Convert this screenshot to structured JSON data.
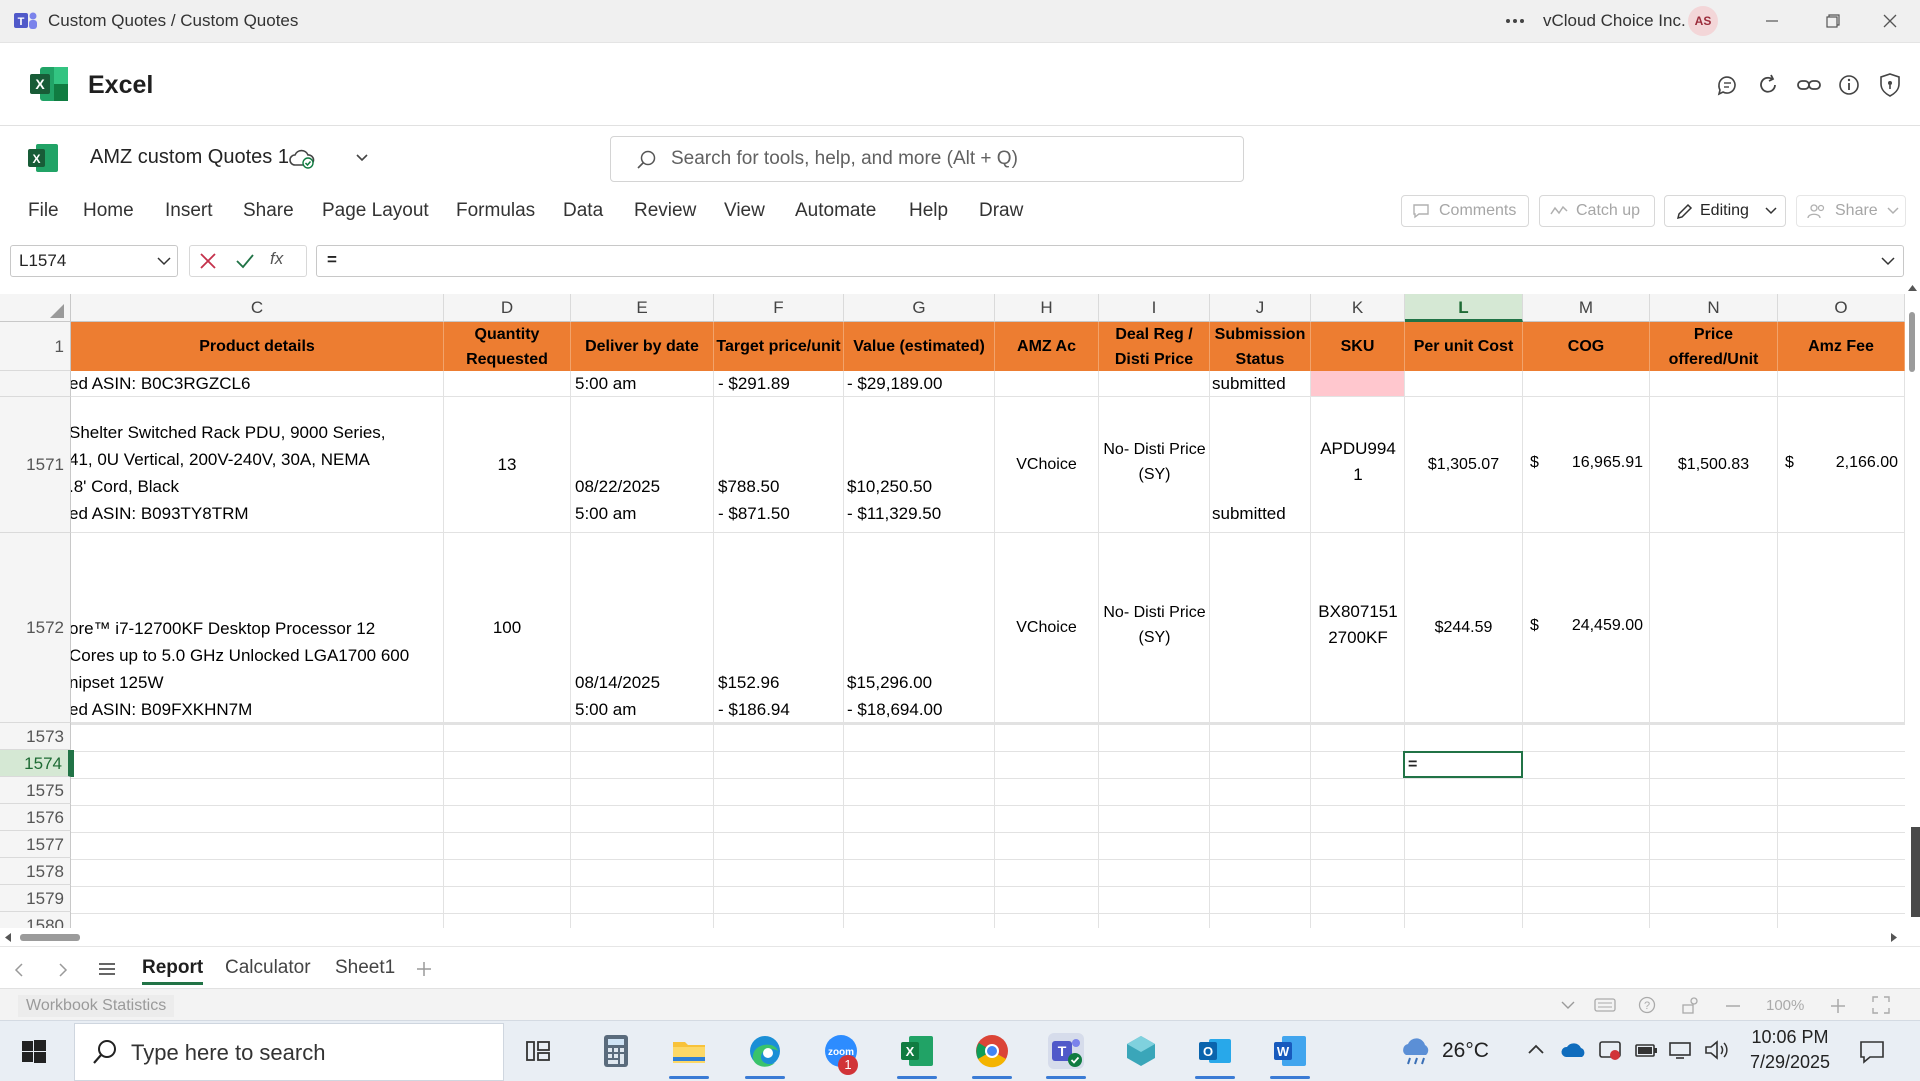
{
  "window": {
    "title": "Custom Quotes / Custom Quotes",
    "org": "vCloud Choice Inc.",
    "avatar": "AS"
  },
  "app": {
    "name": "Excel"
  },
  "file": {
    "name": "AMZ custom Quotes 1"
  },
  "search": {
    "placeholder": "Search for tools, help, and more (Alt + Q)"
  },
  "menu": {
    "items": [
      "File",
      "Home",
      "Insert",
      "Share",
      "Page Layout",
      "Formulas",
      "Data",
      "Review",
      "View",
      "Automate",
      "Help",
      "Draw"
    ],
    "comments": "Comments",
    "catch_up": "Catch up",
    "editing": "Editing",
    "share": "Share"
  },
  "formula_bar": {
    "name_box": "L1574",
    "fx": "fx",
    "formula": "="
  },
  "grid": {
    "columns": [
      "C",
      "D",
      "E",
      "F",
      "G",
      "H",
      "I",
      "J",
      "K",
      "L",
      "M",
      "N",
      "O"
    ],
    "selected_column": "L",
    "header_row_number": "1",
    "headers": {
      "C": "Product details",
      "D1": "Quantity",
      "D2": "Requested",
      "E": "Deliver by date",
      "F": "Target price/unit",
      "G": "Value (estimated)",
      "H": "AMZ Ac",
      "I1": "Deal Reg /",
      "I2": "Disti Price",
      "J1": "Submission",
      "J2": "Status",
      "K": "SKU",
      "L": "Per unit Cost",
      "M": "COG",
      "N1": "Price",
      "N2": "offered/Unit",
      "O": "Amz Fee"
    },
    "row_partial": {
      "c": "ed ASIN: B0C3RGZCL6",
      "e": "5:00 am",
      "f": "- $291.89",
      "g": "- $29,189.00",
      "j": "submitted"
    },
    "row_1571": {
      "num": "1571",
      "c1": "Shelter Switched Rack PDU, 9000 Series,",
      "c2": "41, 0U Vertical, 200V-240V, 30A, NEMA",
      "c3": ".8' Cord, Black",
      "c4": "ed ASIN: B093TY8TRM",
      "d": "13",
      "e1": "08/22/2025",
      "e2": "5:00 am",
      "f1": "$788.50",
      "f2": "- $871.50",
      "g1": "$10,250.50",
      "g2": "- $11,329.50",
      "h": "VChoice",
      "i1": "No- Disti Price",
      "i2": "(SY)",
      "j": "submitted",
      "k1": "APDU994",
      "k2": "1",
      "l": "$1,305.07",
      "m_sym": "$",
      "m": "16,965.91",
      "n": "$1,500.83",
      "o_sym": "$",
      "o": "2,166.00"
    },
    "row_1572": {
      "num": "1572",
      "c1": "ore™ i7-12700KF Desktop Processor 12",
      "c2": "Cores up to 5.0 GHz Unlocked LGA1700 600",
      "c3": "nipset 125W",
      "c4": "ed ASIN: B09FXKHN7M",
      "d": "100",
      "e1": "08/14/2025",
      "e2": "5:00 am",
      "f1": "$152.96",
      "f2": "- $186.94",
      "g1": "$15,296.00",
      "g2": "- $18,694.00",
      "h": "VChoice",
      "i1": "No- Disti Price",
      "i2": "(SY)",
      "k1": "BX807151",
      "k2": "2700KF",
      "l": "$244.59",
      "m_sym": "$",
      "m": "24,459.00"
    },
    "empty_rows": [
      "1573",
      "1574",
      "1575",
      "1576",
      "1577",
      "1578",
      "1579",
      "1580"
    ],
    "active_row": "1574",
    "active_cell_value": "="
  },
  "sheets": {
    "tabs": [
      "Report",
      "Calculator",
      "Sheet1"
    ],
    "active": "Report"
  },
  "statusbar": {
    "workbook_statistics": "Workbook Statistics",
    "zoom": "100%"
  },
  "taskbar": {
    "search_placeholder": "Type here to search",
    "weather": "26°C",
    "time": "10:06 PM",
    "date": "7/29/2025",
    "zoom_badge": "1"
  },
  "colors": {
    "header_orange": "#ed7d31",
    "excel_green": "#217346",
    "sku_highlight": "#ffc7ce"
  }
}
